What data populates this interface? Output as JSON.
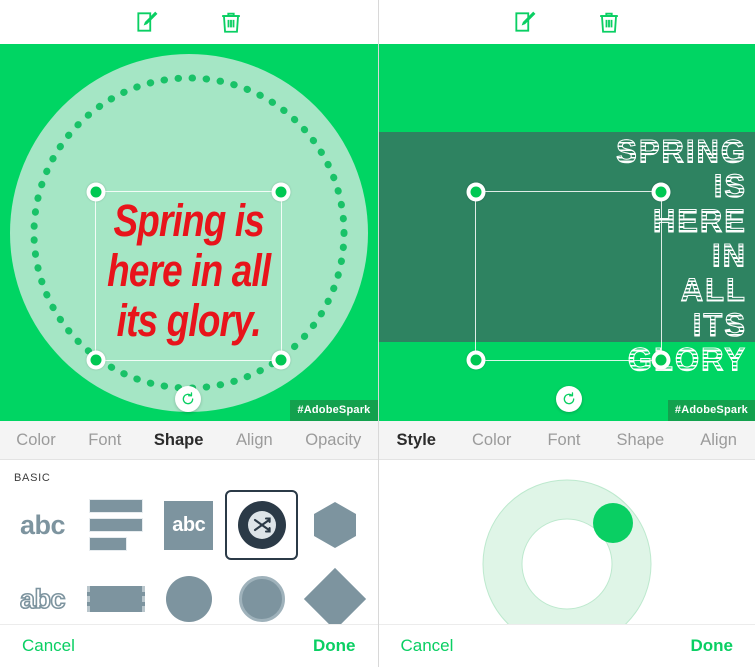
{
  "panels": [
    {
      "id": "left",
      "toolbar": {
        "edit_icon": "edit-square-pencil-icon",
        "delete_icon": "trash-icon"
      },
      "canvas": {
        "background_color": "#00D563",
        "shape": "dotted-ring-circle",
        "shape_fill": "#A5E6C5",
        "text_lines": [
          "Spring is",
          "here in all",
          "its glory."
        ],
        "text_color": "#E8141B",
        "watermark": "#AdobeSpark",
        "rotate_icon": "rotate-ccw-icon"
      },
      "tabs": [
        {
          "label": "Color",
          "active": false
        },
        {
          "label": "Font",
          "active": false
        },
        {
          "label": "Shape",
          "active": true
        },
        {
          "label": "Align",
          "active": false
        },
        {
          "label": "Opacity",
          "active": false
        }
      ],
      "group_label": "BASIC",
      "shapes": [
        {
          "name": "shape-text-plain",
          "icon": "abc-plain-icon",
          "label": "abc",
          "selected": false
        },
        {
          "name": "shape-bars-stacked",
          "icon": "stacked-bars-icon",
          "label": "",
          "selected": false
        },
        {
          "name": "shape-text-box",
          "icon": "abc-filled-box-icon",
          "label": "abc",
          "selected": false
        },
        {
          "name": "shape-badge-shuffle",
          "icon": "shuffle-badge-icon",
          "label": "",
          "selected": true
        },
        {
          "name": "shape-hexagon",
          "icon": "hexagon-icon",
          "label": "",
          "selected": false
        },
        {
          "name": "shape-text-outline",
          "icon": "abc-outline-icon",
          "label": "abc",
          "selected": false
        },
        {
          "name": "shape-bar-dashed",
          "icon": "dashed-bar-icon",
          "label": "",
          "selected": false
        },
        {
          "name": "shape-circle",
          "icon": "circle-icon",
          "label": "",
          "selected": false
        },
        {
          "name": "shape-circle-ring",
          "icon": "circle-ring-icon",
          "label": "",
          "selected": false
        },
        {
          "name": "shape-diamond",
          "icon": "diamond-icon",
          "label": "",
          "selected": false
        }
      ],
      "footer": {
        "cancel": "Cancel",
        "done": "Done"
      }
    },
    {
      "id": "right",
      "toolbar": {
        "edit_icon": "edit-square-pencil-icon",
        "delete_icon": "trash-icon"
      },
      "canvas": {
        "background_color": "#00D563",
        "band_color": "#2E8361",
        "text_lines": [
          "SPRING",
          "IS",
          "HERE",
          "IN",
          "ALL",
          "ITS",
          "GLORY"
        ],
        "text_color": "#FFFFFF",
        "text_style": "striped-lines",
        "watermark": "#AdobeSpark",
        "rotate_icon": "rotate-ccw-icon"
      },
      "tabs": [
        {
          "label": "Style",
          "active": true
        },
        {
          "label": "Color",
          "active": false
        },
        {
          "label": "Font",
          "active": false
        },
        {
          "label": "Shape",
          "active": false
        },
        {
          "label": "Align",
          "active": false
        }
      ],
      "dial": {
        "name": "style-angle-dial",
        "track_color": "#DFF5E7",
        "handle_color": "#0ACF63",
        "handle_angle_deg": 45
      },
      "footer": {
        "cancel": "Cancel",
        "done": "Done"
      }
    }
  ],
  "theme": {
    "accent_green": "#0ACF63",
    "canvas_green": "#00D563",
    "dark_green": "#2E8361",
    "mint": "#A5E6C5",
    "red": "#E8141B",
    "slate": "#7D949F",
    "tabbar_bg": "#F4F4F4"
  }
}
